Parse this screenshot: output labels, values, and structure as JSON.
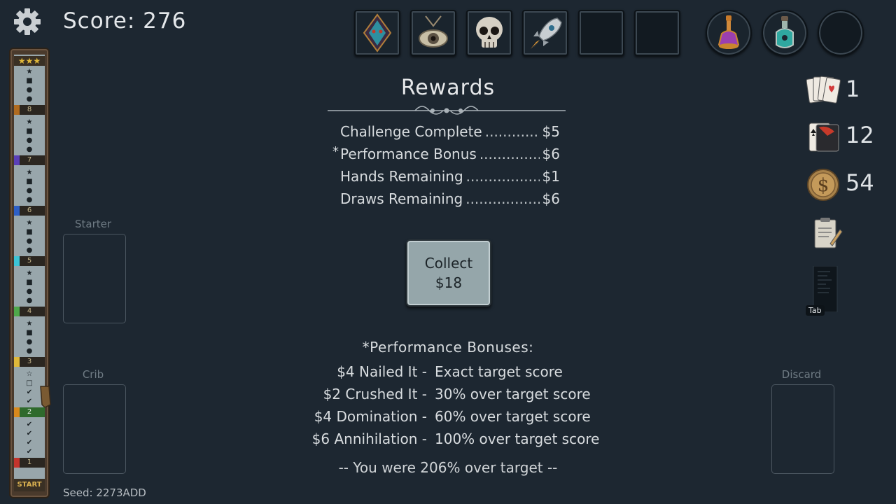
{
  "hud": {
    "score_label": "Score: 276",
    "seed_label": "Seed: 2273ADD"
  },
  "items": [
    {
      "name": "mask-icon"
    },
    {
      "name": "eye-amulet-icon"
    },
    {
      "name": "skull-icon"
    },
    {
      "name": "rocket-icon"
    },
    {
      "name": "empty"
    },
    {
      "name": "empty"
    }
  ],
  "potions": [
    {
      "name": "purple-potion-icon"
    },
    {
      "name": "teal-potion-icon"
    },
    {
      "name": "empty"
    }
  ],
  "rewards": {
    "title": "Rewards",
    "rows": [
      {
        "label": "Challenge Complete",
        "value": "$5",
        "starred": false
      },
      {
        "label": "Performance Bonus",
        "value": "$6",
        "starred": true
      },
      {
        "label": "Hands Remaining",
        "value": "$1",
        "starred": false
      },
      {
        "label": "Draws Remaining",
        "value": "$6",
        "starred": false
      }
    ],
    "star_mark": "*",
    "collect_line1": "Collect",
    "collect_line2": "$18"
  },
  "bonuses": {
    "title": "*Performance Bonuses:",
    "rows": [
      {
        "left": "$4 Nailed It -",
        "right": "Exact target score"
      },
      {
        "left": "$2 Crushed It -",
        "right": "30% over target score"
      },
      {
        "left": "$4 Domination -",
        "right": "60% over target score"
      },
      {
        "left": "$6 Annihilation -",
        "right": "100% over target score"
      }
    ],
    "result": "-- You were 206% over target --"
  },
  "piles": {
    "starter": "Starter",
    "crib": "Crib",
    "discard": "Discard"
  },
  "stats": {
    "hands": "1",
    "cards": "12",
    "money": "54",
    "tab_hint": "Tab"
  },
  "progress": {
    "levels": [
      "8",
      "7",
      "6",
      "5",
      "4",
      "3",
      "2",
      "1"
    ],
    "level_colors": [
      "#b06a1e",
      "#5a3fb8",
      "#2d5fc6",
      "#3cc4d6",
      "#4ea84a",
      "#e0b83a",
      "#d8881c",
      "#c4342c"
    ],
    "start_label": "START"
  },
  "colors": {
    "background": "#1d2731",
    "button": "#95a6aa",
    "text": "#d9dde0"
  }
}
